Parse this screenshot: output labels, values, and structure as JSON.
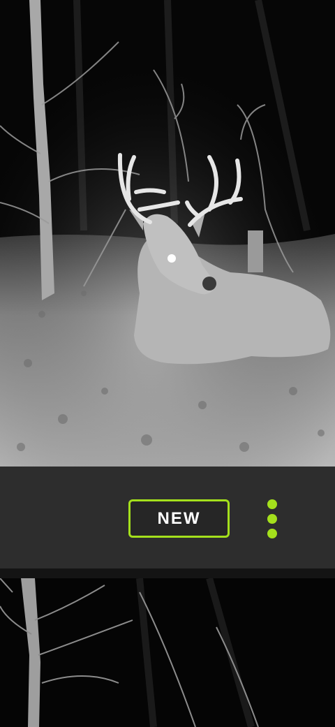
{
  "card": {
    "badge_label": "NEW",
    "menu_icon": "more-vertical-icon",
    "accent_color": "#a4e01c",
    "bar_color": "#2d2d2d"
  },
  "photos": [
    {
      "subject": "trail-camera-night-photo-buck"
    },
    {
      "subject": "trail-camera-night-photo-trees"
    }
  ]
}
